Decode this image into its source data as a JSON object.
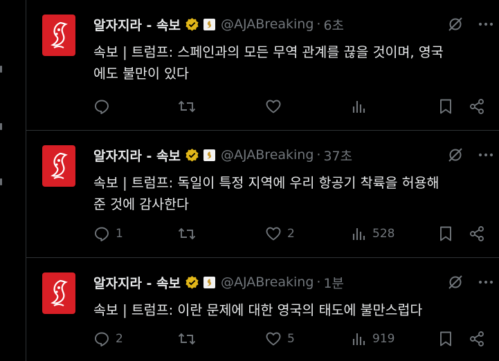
{
  "tweets": [
    {
      "author": "알자지라 - 속보",
      "handle": "@AJABreaking",
      "time": "6초",
      "text_line1": "속보 | 트럼프: 스페인과의 모든 무역 관계를 끊을 것이며, 영국",
      "text_line2": "에도 불만이 있다",
      "replies": "",
      "reposts": "",
      "likes": "",
      "views": ""
    },
    {
      "author": "알자지라 - 속보",
      "handle": "@AJABreaking",
      "time": "37초",
      "text_line1": "속보 | 트럼프: 독일이 특정 지역에 우리 항공기 착륙을 허용해",
      "text_line2": "준 것에 감사한다",
      "replies": "1",
      "reposts": "",
      "likes": "2",
      "views": "528"
    },
    {
      "author": "알자지라 - 속보",
      "handle": "@AJABreaking",
      "time": "1분",
      "text_line1": "속보 | 트럼프: 이란 문제에 대한 영국의 태도에 불만스럽다",
      "text_line2": "",
      "replies": "2",
      "reposts": "",
      "likes": "5",
      "views": "919"
    }
  ],
  "separator": "·",
  "colors": {
    "background": "#000000",
    "text": "#e7e9ea",
    "muted": "#71767b",
    "divider": "#2f3336",
    "avatar_red": "#d81f26",
    "verified_gold": "#e2b719"
  },
  "icons": {
    "avatar": "al-jazeera-logo",
    "verified": "gold-verified-badge-icon",
    "affiliate": "al-jazeera-affiliate-badge-icon",
    "grok": "grok-icon",
    "more": "more-dots-icon",
    "reply": "reply-icon",
    "repost": "repost-icon",
    "like": "heart-icon",
    "views": "views-chart-icon",
    "bookmark": "bookmark-icon",
    "share": "share-icon"
  }
}
